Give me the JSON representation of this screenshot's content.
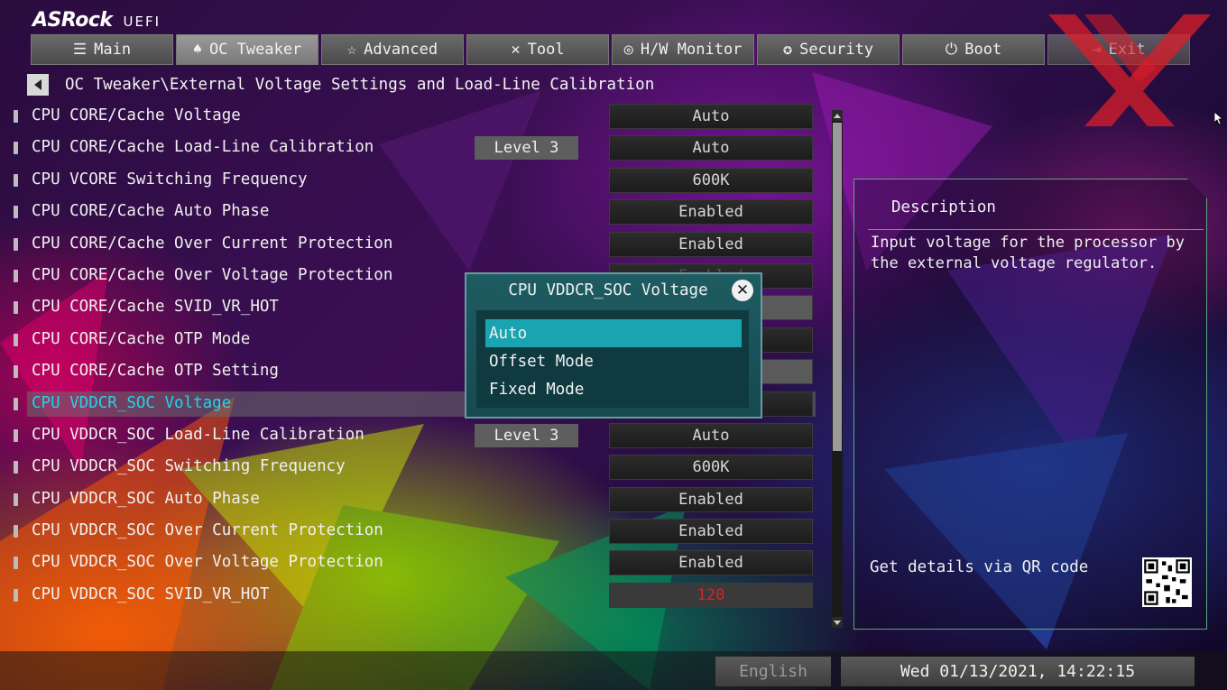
{
  "brand": {
    "name": "ASRock",
    "suffix": "UEFI"
  },
  "tabs": [
    {
      "label": "Main",
      "icon": "list-icon",
      "active": false
    },
    {
      "label": "OC Tweaker",
      "icon": "rocket-icon",
      "active": true
    },
    {
      "label": "Advanced",
      "icon": "star-icon",
      "active": false
    },
    {
      "label": "Tool",
      "icon": "tools-icon",
      "active": false
    },
    {
      "label": "H/W Monitor",
      "icon": "monitor-icon",
      "active": false
    },
    {
      "label": "Security",
      "icon": "shield-icon",
      "active": false
    },
    {
      "label": "Boot",
      "icon": "power-icon",
      "active": false
    },
    {
      "label": "Exit",
      "icon": "exit-icon",
      "active": false
    }
  ],
  "breadcrumb": "OC Tweaker\\External Voltage Settings and Load-Line Calibration",
  "settings": [
    {
      "label": "CPU CORE/Cache Voltage",
      "level": "",
      "value": "Auto"
    },
    {
      "label": "CPU CORE/Cache Load-Line Calibration",
      "level": "Level 3",
      "value": "Auto"
    },
    {
      "label": "CPU VCORE Switching Frequency",
      "level": "",
      "value": "600K"
    },
    {
      "label": "CPU CORE/Cache Auto Phase",
      "level": "",
      "value": "Enabled"
    },
    {
      "label": "CPU CORE/Cache Over Current Protection",
      "level": "",
      "value": "Enabled"
    },
    {
      "label": "CPU CORE/Cache Over Voltage Protection",
      "level": "",
      "value": "Enabled"
    },
    {
      "label": "CPU CORE/Cache SVID_VR_HOT",
      "level": "",
      "value": ""
    },
    {
      "label": "CPU CORE/Cache OTP Mode",
      "level": "",
      "value": ""
    },
    {
      "label": "CPU CORE/Cache OTP Setting",
      "level": "",
      "value": ""
    },
    {
      "label": "CPU VDDCR_SOC Voltage",
      "level": "",
      "value": "Auto"
    },
    {
      "label": "CPU VDDCR_SOC Load-Line Calibration",
      "level": "Level 3",
      "value": "Auto"
    },
    {
      "label": "CPU VDDCR_SOC Switching Frequency",
      "level": "",
      "value": "600K"
    },
    {
      "label": "CPU VDDCR_SOC Auto Phase",
      "level": "",
      "value": "Enabled"
    },
    {
      "label": "CPU VDDCR_SOC Over Current Protection",
      "level": "",
      "value": "Enabled"
    },
    {
      "label": "CPU VDDCR_SOC Over Voltage Protection",
      "level": "",
      "value": "Enabled"
    },
    {
      "label": "CPU VDDCR_SOC SVID_VR_HOT",
      "level": "",
      "value": "120"
    }
  ],
  "selected_index": 9,
  "popup": {
    "title": "CPU VDDCR_SOC Voltage",
    "options": [
      "Auto",
      "Offset Mode",
      "Fixed Mode"
    ],
    "selected": "Auto"
  },
  "description": {
    "title": "Description",
    "text": "Input voltage for the processor by\nthe external voltage regulator.",
    "qr_label": "Get details via QR code"
  },
  "footer": {
    "language": "English",
    "datetime": "Wed 01/13/2021, 14:22:15"
  },
  "colors": {
    "highlight_text": "#22d3e8",
    "popup_selection": "#1aa3b0",
    "warning_value": "#e02020"
  }
}
